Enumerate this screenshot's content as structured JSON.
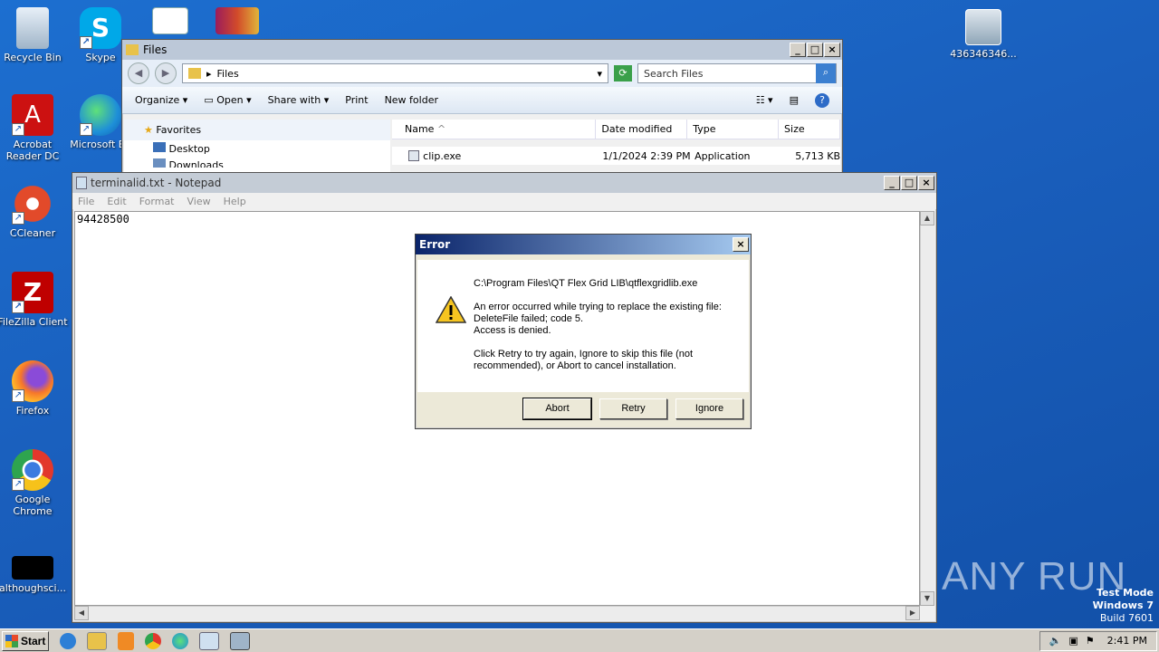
{
  "desktop": {
    "icons": [
      {
        "label": "Recycle Bin"
      },
      {
        "label": "Skype"
      },
      {
        "label": "Acrobat Reader DC"
      },
      {
        "label": "Microsoft Ed"
      },
      {
        "label": "CCleaner"
      },
      {
        "label": "FileZilla Client"
      },
      {
        "label": "Firefox"
      },
      {
        "label": "Google Chrome"
      },
      {
        "label": "althoughsci..."
      },
      {
        "label": "436346346..."
      }
    ]
  },
  "explorer": {
    "title": "Files",
    "address": "Files",
    "search_placeholder": "Search Files",
    "toolbar": {
      "organize": "Organize",
      "open": "Open",
      "share_with": "Share with",
      "print": "Print",
      "new_folder": "New folder"
    },
    "columns": {
      "name": "Name",
      "date_modified": "Date modified",
      "type": "Type",
      "size": "Size"
    },
    "nav": {
      "favorites": "Favorites",
      "desktop": "Desktop",
      "downloads": "Downloads"
    },
    "files": [
      {
        "name": "clip.exe",
        "date": "1/1/2024 2:39 PM",
        "type": "Application",
        "size": "5,713 KB"
      }
    ]
  },
  "notepad": {
    "title": "terminalid.txt - Notepad",
    "menu": {
      "file": "File",
      "edit": "Edit",
      "format": "Format",
      "view": "View",
      "help": "Help"
    },
    "content": "94428500"
  },
  "error_dialog": {
    "title": "Error",
    "path": "C:\\Program Files\\QT Flex Grid LIB\\qtflexgridlib.exe",
    "line1": "An error occurred while trying to replace the existing file:",
    "line2": "DeleteFile failed; code 5.",
    "line3": "Access is denied.",
    "line4": "Click Retry to try again, Ignore to skip this file (not recommended), or Abort to cancel installation.",
    "buttons": {
      "abort": "Abort",
      "retry": "Retry",
      "ignore": "Ignore"
    }
  },
  "taskbar": {
    "start_label": "Start",
    "clock": "2:41 PM"
  },
  "watermark": {
    "line1": "Test Mode",
    "line2": "Windows 7",
    "line3": "Build 7601",
    "brand": "ANY RUN"
  }
}
